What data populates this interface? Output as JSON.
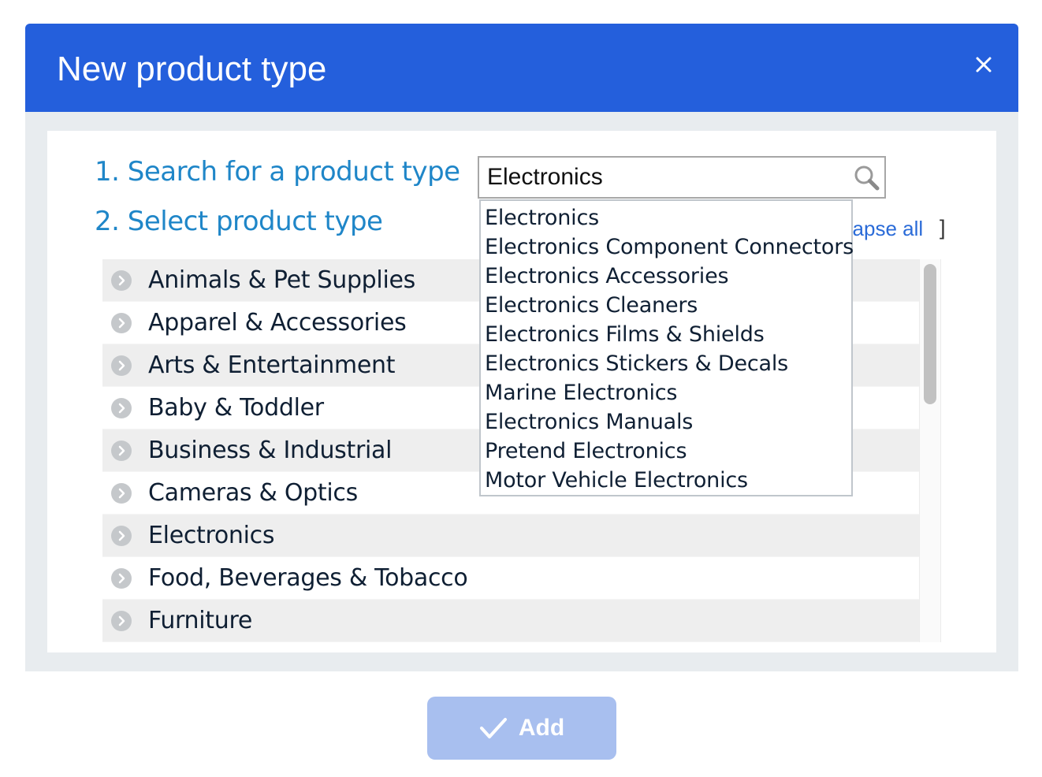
{
  "dialog": {
    "title": "New product type",
    "close_icon": "close-icon"
  },
  "steps": {
    "search_label": "1. Search for a product type",
    "select_label": "2. Select product type"
  },
  "search": {
    "value": "Electronics",
    "icon": "search-icon"
  },
  "tree_controls": {
    "collapse_all_visible_text": "llapse all",
    "bracket": "]"
  },
  "suggestions": [
    "Electronics",
    "Electronics Component Connectors",
    "Electronics Accessories",
    "Electronics Cleaners",
    "Electronics Films & Shields",
    "Electronics Stickers & Decals",
    "Marine Electronics",
    "Electronics Manuals",
    "Pretend Electronics",
    "Motor Vehicle Electronics"
  ],
  "categories": [
    "Animals & Pet Supplies",
    "Apparel & Accessories",
    "Arts & Entertainment",
    "Baby & Toddler",
    "Business & Industrial",
    "Cameras & Optics",
    "Electronics",
    "Food, Beverages & Tobacco",
    "Furniture"
  ],
  "footer": {
    "add_label": "Add",
    "add_icon": "checkmark-icon",
    "add_disabled": true
  },
  "colors": {
    "header": "#245fdc",
    "step_label": "#1f86c8",
    "link": "#2a6bd8",
    "add_button_disabled": "#a8bfef"
  }
}
